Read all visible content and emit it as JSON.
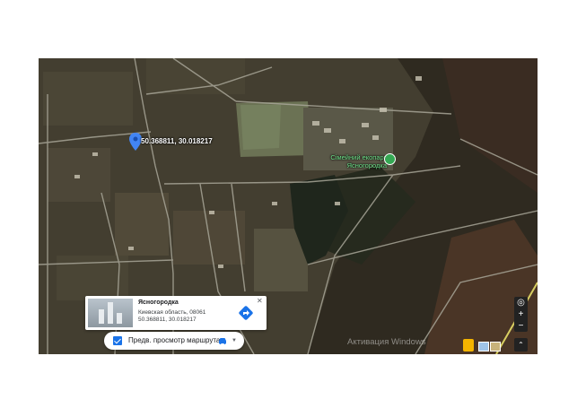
{
  "map": {
    "marker_coords": "50.368811, 30.018217",
    "poi_label": "Сімейний екопарк Ясногородка"
  },
  "info_card": {
    "title": "Ясногородка",
    "region": "Киевская область, 08061",
    "coords": "50.368811, 30.018217",
    "close_symbol": "✕"
  },
  "route_bar": {
    "label": "Предв. просмотр маршрута",
    "checked": true,
    "mode_icon": "car-icon"
  },
  "controls": {
    "zoom_in": "+",
    "zoom_out": "−",
    "locate_icon": "locate-icon",
    "collapse_icon": "chevron-up-icon"
  },
  "watermark": "Активация Windows",
  "colors": {
    "marker_blue": "#4285f4",
    "poi_green": "#34a853",
    "check_blue": "#1a73e8"
  }
}
